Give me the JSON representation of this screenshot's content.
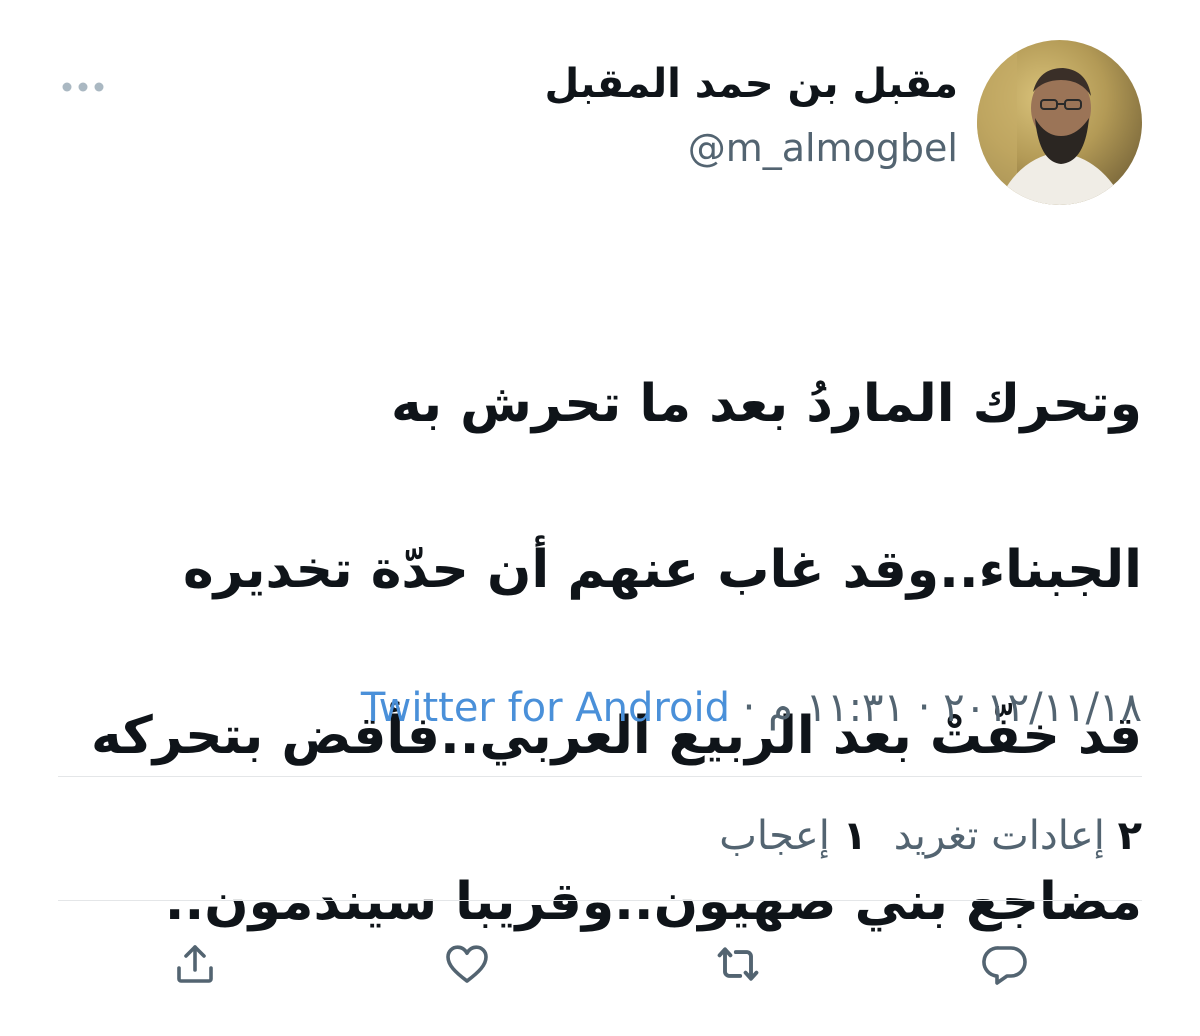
{
  "tweet": {
    "display_name": "مقبل بن حمد المقبل",
    "handle": "@m_almogbel",
    "text_lines": [
      "وتحرك الماردُ بعد ما تحرش به",
      "الجبناء..وقد غاب عنهم أن حدّة تخديره",
      "قد خفّتْ بعد الربيع العربي..فأقض بتحركه",
      "مضاجع بني صهيون..وقريبا سيندمون.."
    ],
    "date": "٢٠١٢/١١/١٨",
    "time": "١١:٣١ م",
    "separator": "·",
    "source": "Twitter for Android"
  },
  "stats": {
    "retweets_count": "٢",
    "retweets_label": "إعادات تغريد",
    "likes_count": "١",
    "likes_label": "إعجاب"
  },
  "icons": {
    "more": "more-dots-icon",
    "reply": "reply-icon",
    "retweet": "retweet-icon",
    "like": "heart-icon",
    "share": "share-icon"
  },
  "colors": {
    "text": "#0f1419",
    "secondary": "#536471",
    "link": "#4a90d9",
    "divider": "#e4e6e8"
  }
}
